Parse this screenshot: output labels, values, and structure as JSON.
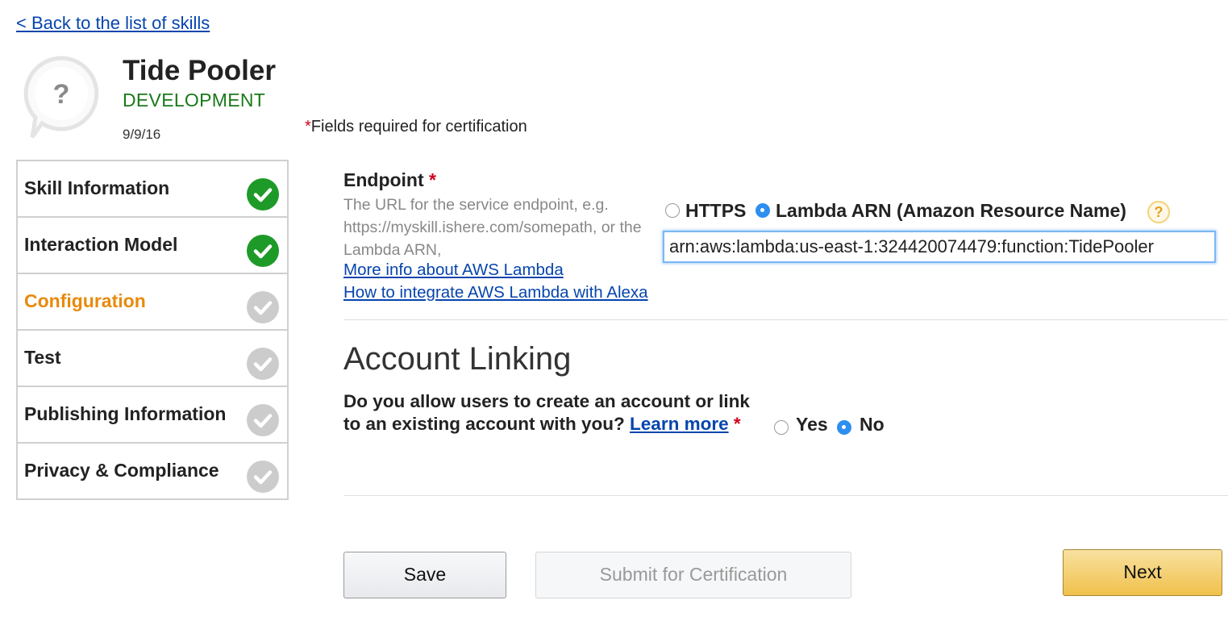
{
  "header": {
    "back_link": "< Back to the list of skills",
    "skill_name": "Tide Pooler",
    "skill_status": "DEVELOPMENT",
    "skill_date": "9/9/16",
    "required_note": "Fields required for certification",
    "required_star": "*"
  },
  "sidebar": {
    "items": [
      {
        "label": "Skill Information",
        "complete": true,
        "active": false
      },
      {
        "label": "Interaction Model",
        "complete": true,
        "active": false
      },
      {
        "label": "Configuration",
        "complete": false,
        "active": true
      },
      {
        "label": "Test",
        "complete": false,
        "active": false
      },
      {
        "label": "Publishing Information",
        "complete": false,
        "active": false
      },
      {
        "label": "Privacy & Compliance",
        "complete": false,
        "active": false
      }
    ]
  },
  "endpoint": {
    "title": "Endpoint",
    "star": "*",
    "description": "The URL for the service endpoint, e.g. https://myskill.ishere.com/somepath, or the Lambda ARN,",
    "link_lambda_info": "More info about AWS Lambda",
    "link_lambda_alexa": "How to integrate AWS Lambda with Alexa",
    "option_https": "HTTPS",
    "option_lambda": "Lambda ARN (Amazon Resource Name)",
    "selected": "Lambda ARN (Amazon Resource Name)",
    "help_icon": "?",
    "arn_value": "arn:aws:lambda:us-east-1:324420074479:function:TidePooler"
  },
  "account_linking": {
    "title": "Account Linking",
    "question": "Do you allow users to create an account or link to an existing account with you?",
    "learn_more": "Learn more",
    "star": "*",
    "option_yes": "Yes",
    "option_no": "No",
    "selected": "No"
  },
  "buttons": {
    "save": "Save",
    "submit": "Submit for Certification",
    "next": "Next"
  },
  "colors": {
    "link": "#0645ad",
    "status_green": "#1a7a1a",
    "active_nav": "#e88a0c",
    "check_complete": "#1e9a28",
    "check_incomplete": "#cccccc",
    "radio_selected": "#2d8ff0",
    "next_button": "#f0c14b",
    "required": "#d0021b"
  },
  "icons": {
    "skill_icon": "speech-bubble-question-icon",
    "complete": "check-circle-icon",
    "help": "help-icon"
  }
}
